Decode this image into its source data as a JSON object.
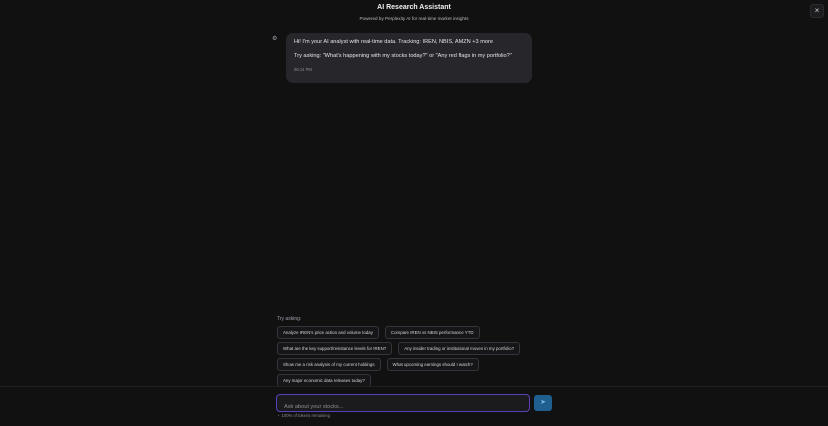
{
  "header": {
    "title": "AI Research Assistant",
    "subtitle": "Powered by Perplexity AI for real-time market insights",
    "close_icon": "×"
  },
  "message": {
    "icon": "bot-icon",
    "line1": "Hi! I'm your AI analyst with real-time data. Tracking: IREN, NBIS, AMZN +3 more",
    "line2": "Try asking: \"What's happening with my stocks today?\" or \"Any red flags in my portfolio?\"",
    "time": "06:14 PM"
  },
  "suggestions": {
    "label": "Try asking:",
    "items": [
      "Analyze IREN's price action and volume today",
      "Compare IREN vs NBIS performance YTD",
      "What are the key support/resistance levels for IREN?",
      "Any insider trading or institutional moves in my portfolio?",
      "Show me a risk analysis of my current holdings",
      "What upcoming earnings should I watch?",
      "Any major economic data releases today?"
    ]
  },
  "composer": {
    "placeholder": "Ask about your stocks...",
    "send_icon": "send-icon",
    "tokens_text": "100% of tokens remaining"
  },
  "colors": {
    "background": "#111112",
    "bubble": "#27272b",
    "input_border": "#5b3fb8",
    "send_button": "#1e5f8f"
  }
}
